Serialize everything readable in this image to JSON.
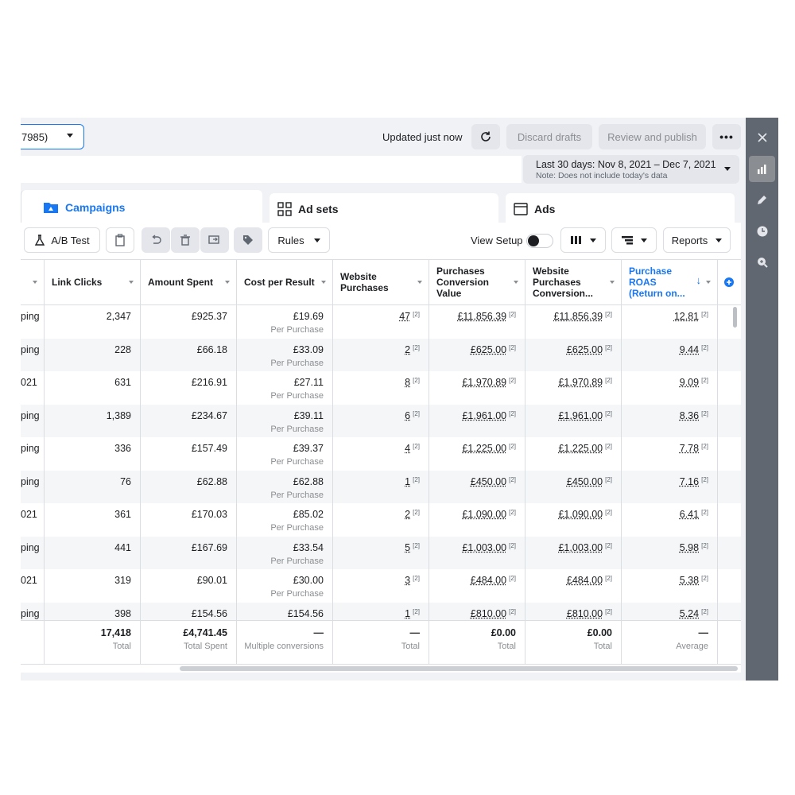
{
  "topbar": {
    "account_select_value": "7985)",
    "updated_text": "Updated just now",
    "discard_label": "Discard drafts",
    "review_label": "Review and publish",
    "more_label": "•••"
  },
  "date_range": {
    "label": "Last 30 days: Nov 8, 2021 – Dec 7, 2021",
    "note": "Note: Does not include today's data"
  },
  "tabs": [
    {
      "label": "Campaigns",
      "active": true
    },
    {
      "label": "Ad sets",
      "active": false
    },
    {
      "label": "Ads",
      "active": false
    }
  ],
  "toolbar": {
    "ab_test_label": "A/B Test",
    "rules_label": "Rules",
    "view_setup_label": "View Setup",
    "reports_label": "Reports"
  },
  "table": {
    "columns": [
      {
        "label": ""
      },
      {
        "label": "Link Clicks"
      },
      {
        "label": "Amount Spent"
      },
      {
        "label": "Cost per Result"
      },
      {
        "label": "Website Purchases"
      },
      {
        "label": "Purchases Conversion Value"
      },
      {
        "label": "Website Purchases Conversion..."
      },
      {
        "label": "Purchase ROAS (Return on..."
      }
    ],
    "rows": [
      {
        "name": "ping",
        "clicks": "2,347",
        "spent": "£925.37",
        "cpr": "£19.69",
        "cpr_sub": "Per Purchase",
        "purchases": "47",
        "conv_value": "£11,856.39",
        "web_conv": "£11,856.39",
        "roas": "12.81"
      },
      {
        "name": "ping",
        "clicks": "228",
        "spent": "£66.18",
        "cpr": "£33.09",
        "cpr_sub": "Per Purchase",
        "purchases": "2",
        "conv_value": "£625.00",
        "web_conv": "£625.00",
        "roas": "9.44"
      },
      {
        "name": "021",
        "clicks": "631",
        "spent": "£216.91",
        "cpr": "£27.11",
        "cpr_sub": "Per Purchase",
        "purchases": "8",
        "conv_value": "£1,970.89",
        "web_conv": "£1,970.89",
        "roas": "9.09"
      },
      {
        "name": "ping",
        "clicks": "1,389",
        "spent": "£234.67",
        "cpr": "£39.11",
        "cpr_sub": "Per Purchase",
        "purchases": "6",
        "conv_value": "£1,961.00",
        "web_conv": "£1,961.00",
        "roas": "8.36"
      },
      {
        "name": "ping",
        "clicks": "336",
        "spent": "£157.49",
        "cpr": "£39.37",
        "cpr_sub": "Per Purchase",
        "purchases": "4",
        "conv_value": "£1,225.00",
        "web_conv": "£1,225.00",
        "roas": "7.78"
      },
      {
        "name": "ping",
        "clicks": "76",
        "spent": "£62.88",
        "cpr": "£62.88",
        "cpr_sub": "Per Purchase",
        "purchases": "1",
        "conv_value": "£450.00",
        "web_conv": "£450.00",
        "roas": "7.16"
      },
      {
        "name": "021",
        "clicks": "361",
        "spent": "£170.03",
        "cpr": "£85.02",
        "cpr_sub": "Per Purchase",
        "purchases": "2",
        "conv_value": "£1,090.00",
        "web_conv": "£1,090.00",
        "roas": "6.41"
      },
      {
        "name": "ping",
        "clicks": "441",
        "spent": "£167.69",
        "cpr": "£33.54",
        "cpr_sub": "Per Purchase",
        "purchases": "5",
        "conv_value": "£1,003.00",
        "web_conv": "£1,003.00",
        "roas": "5.98"
      },
      {
        "name": "021",
        "clicks": "319",
        "spent": "£90.01",
        "cpr": "£30.00",
        "cpr_sub": "Per Purchase",
        "purchases": "3",
        "conv_value": "£484.00",
        "web_conv": "£484.00",
        "roas": "5.38"
      },
      {
        "name": "ping",
        "clicks": "398",
        "spent": "£154.56",
        "cpr": "£154.56",
        "cpr_sub": "",
        "purchases": "1",
        "conv_value": "£810.00",
        "web_conv": "£810.00",
        "roas": "5.24"
      }
    ],
    "footnote_marker": "[2]",
    "totals": {
      "clicks": {
        "value": "17,418",
        "label": "Total"
      },
      "spent": {
        "value": "£4,741.45",
        "label": "Total Spent"
      },
      "cpr": {
        "value": "—",
        "label": "Multiple conversions"
      },
      "purchases": {
        "value": "—",
        "label": "Total"
      },
      "conv_value": {
        "value": "£0.00",
        "label": "Total"
      },
      "web_conv": {
        "value": "£0.00",
        "label": "Total"
      },
      "roas": {
        "value": "—",
        "label": "Average"
      }
    }
  },
  "colors": {
    "accent": "#1877f2",
    "sidebar": "#606770",
    "panel_bg": "#f0f2f5"
  },
  "icons": [
    "refresh-icon",
    "flask-icon",
    "clipboard-icon",
    "undo-icon",
    "trash-icon",
    "duplicate-icon",
    "tag-icon",
    "columns-icon",
    "breakdown-icon",
    "add-column-icon",
    "close-icon",
    "chart-icon",
    "pencil-icon",
    "clock-icon",
    "zoom-icon",
    "folder-icon",
    "grid-icon",
    "ad-icon",
    "sort-down-icon"
  ]
}
